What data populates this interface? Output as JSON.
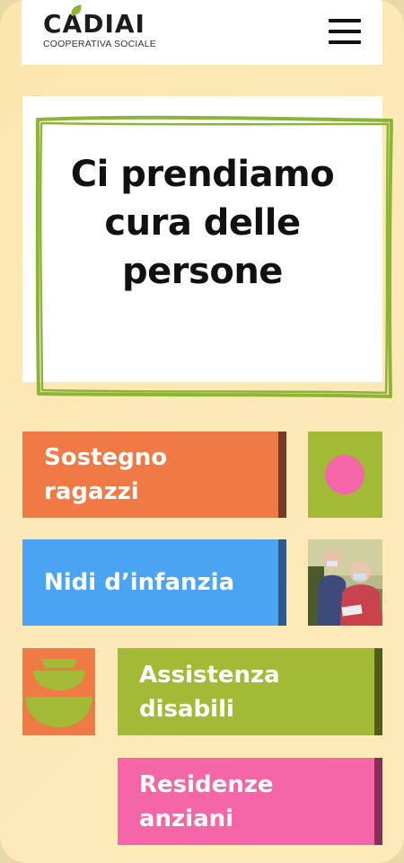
{
  "header": {
    "logo_name": "CADIAI",
    "logo_subtitle": "COOPERATIVA SOCIALE",
    "menu_icon": "hamburger-menu-icon"
  },
  "hero": {
    "title_lines": [
      "Ci prendiamo",
      "cura delle",
      "persone"
    ]
  },
  "cards": {
    "sostegno": {
      "line1": "Sostegno",
      "line2": "ragazzi",
      "color": "#f07a45",
      "edge": "#7a3a22"
    },
    "nidi": {
      "line1": "Nidi d’infanzia",
      "color": "#4ba4f3",
      "edge": "#2a5a8e"
    },
    "assistenza": {
      "line1": "Assistenza",
      "line2": "disabili",
      "color": "#a2ba35",
      "edge": "#4f5d1a"
    },
    "residenze": {
      "line1": "Residenze",
      "line2": "anziani",
      "color": "#f466a8",
      "edge": "#8a2f5c"
    }
  },
  "colors": {
    "accent_green": "#a2ba35",
    "accent_pink": "#f466a8",
    "accent_orange": "#f07a45",
    "background": "#fde9b8"
  }
}
